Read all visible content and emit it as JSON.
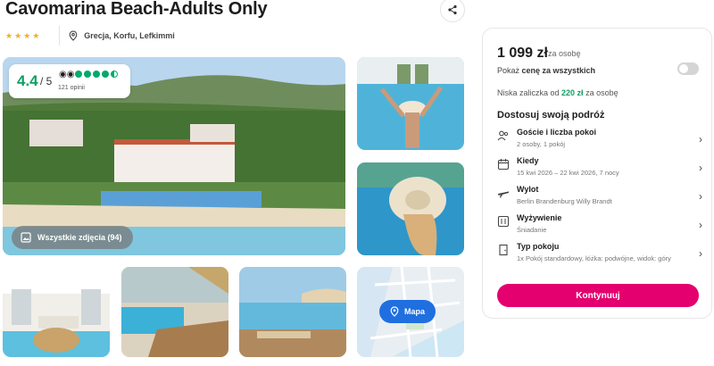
{
  "hotel": {
    "title": "Cavomarina Beach-Adults Only",
    "stars": "★★★★",
    "location": "Grecja, Korfu, Lefkimmi"
  },
  "rating": {
    "score": "4.4",
    "out_of": "/ 5",
    "reviews": "121 opinii",
    "dots_filled": 4.5
  },
  "gallery": {
    "all_photos_label": "Wszystkie zdjęcia (94)",
    "map_label": "Mapa"
  },
  "booking": {
    "price": "1 099 zł",
    "per_person": "za osobę",
    "show_all_prefix": "Pokaż ",
    "show_all_bold": "cenę za wszystkich",
    "deposit_prefix": "Niska zaliczka od ",
    "deposit_amount": "220 zł",
    "deposit_suffix": " za osobę",
    "customize_title": "Dostosuj swoją podróż",
    "options": [
      {
        "label": "Goście i liczba pokoi",
        "value": "2 osoby, 1 pokój",
        "icon": "guests-icon"
      },
      {
        "label": "Kiedy",
        "value": "15 kwi 2026 – 22 kwi 2026, 7 nocy",
        "icon": "calendar-icon"
      },
      {
        "label": "Wylot",
        "value": "Berlin Brandenburg Willy Brandt",
        "icon": "plane-icon"
      },
      {
        "label": "Wyżywienie",
        "value": "Śniadanie",
        "icon": "meal-icon"
      },
      {
        "label": "Typ pokoju",
        "value": "1x Pokój standardowy, łóżka: podwójne, widok: góry",
        "icon": "room-icon"
      }
    ],
    "continue_label": "Kontynuuj"
  },
  "colors": {
    "accent": "#e4006e",
    "rating_green": "#0e9f62",
    "map_blue": "#1f6fe0"
  }
}
